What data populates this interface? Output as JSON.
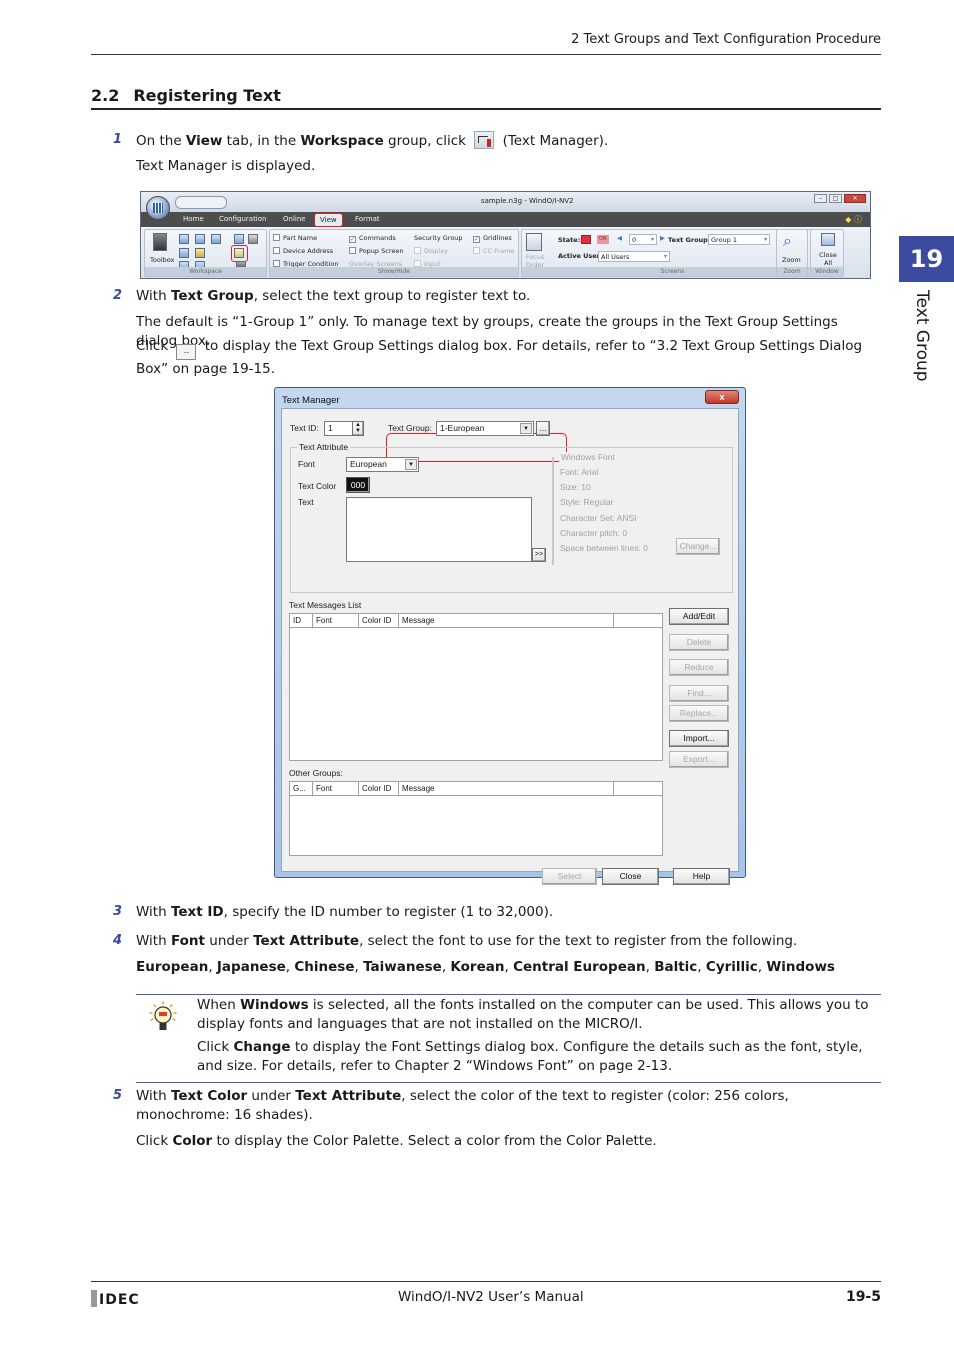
{
  "header": {
    "running_title": "2 Text Groups and Text Configuration Procedure"
  },
  "section": {
    "number": "2.2",
    "title": "Registering Text"
  },
  "chapter_tab": {
    "number": "19",
    "label": "Text Group",
    "color": "#3c4aa0"
  },
  "steps": {
    "s1": {
      "num": "1",
      "t1": "On the ",
      "b1": "View",
      "t2": " tab, in the ",
      "b2": "Workspace",
      "t3": " group, click ",
      "t4": " (Text Manager).",
      "icon": "text-manager-icon",
      "result": "Text Manager is displayed."
    },
    "s2": {
      "num": "2",
      "t1": "With ",
      "b1": "Text Group",
      "t2": ", select the text group to register text to.",
      "p2": "The default is “1-Group 1” only. To manage text by groups, create the groups in the Text Group Settings dialog box.",
      "p3a": "Click ",
      "p3_button": "..",
      "p3b": " to display the Text Group Settings dialog box. For details, refer to “3.2 Text Group Settings Dialog Box” on page 19-15."
    },
    "s3": {
      "num": "3",
      "t1": "With ",
      "b1": "Text ID",
      "t2": ", specify the ID number to register (1 to 32,000)."
    },
    "s4": {
      "num": "4",
      "t1": "With ",
      "b1": "Font",
      "t2": " under ",
      "b2": "Text Attribute",
      "t3": ", select the font to use for the text to register from the following.",
      "fonts": [
        "European",
        "Japanese",
        "Chinese",
        "Taiwanese",
        "Korean",
        "Central European",
        "Baltic",
        "Cyrillic",
        "Windows"
      ]
    },
    "s5": {
      "num": "5",
      "t1": "With ",
      "b1": "Text Color",
      "t2": " under ",
      "b2": "Text Attribute",
      "t3": ", select the color of the text to register (color: 256 colors, monochrome: 16 shades).",
      "p2a": "Click ",
      "p2b": "Color",
      "p2c": " to display the Color Palette. Select a color from the Color Palette."
    }
  },
  "note": {
    "icon": "lightbulb-icon",
    "l1a": "When ",
    "l1b": "Windows",
    "l1c": " is selected, all the fonts installed on the computer can be used. This allows you to display fonts and languages that are not installed on the MICRO/I.",
    "l2a": "Click ",
    "l2b": "Change",
    "l2c": " to display the Font Settings dialog box. Configure the details such as the font, style, and size. For details, refer to Chapter 2 “Windows Font” on page 2-13."
  },
  "ribbon": {
    "window_title": "sample.n3g - WindO/I-NV2",
    "tabs": [
      "Home",
      "Configuration",
      "Online",
      "View",
      "Format"
    ],
    "active_tab": "View",
    "workspace": {
      "toolbox": "Toolbox",
      "group_label": "Workspace"
    },
    "showhide": {
      "items": [
        {
          "label": "Part Name",
          "checked": false,
          "enabled": true
        },
        {
          "label": "Device Address",
          "checked": false,
          "enabled": true
        },
        {
          "label": "Trigger Condition",
          "checked": false,
          "enabled": true
        },
        {
          "label": "Commands",
          "checked": true,
          "enabled": true
        },
        {
          "label": "Popup Screen",
          "checked": false,
          "enabled": true
        },
        {
          "label": "Overlay Screens",
          "enabled": false
        },
        {
          "label": "Security Group",
          "enabled": true
        },
        {
          "label": "Display",
          "checked": false,
          "enabled": false
        },
        {
          "label": "Input",
          "checked": false,
          "enabled": false
        },
        {
          "label": "Gridlines",
          "checked": true,
          "enabled": true
        },
        {
          "label": "CC Frame",
          "checked": false,
          "enabled": false
        }
      ],
      "group_label": "Show/Hide"
    },
    "screens": {
      "focus_order": "Focus Order",
      "state_label": "State:",
      "state_value": "0",
      "on_badge": "ON",
      "text_group_label": "Text Group:",
      "text_group_value": "Group 1",
      "active_user_label": "Active User:",
      "active_user_value": "All Users",
      "group_label": "Screens"
    },
    "zoom": {
      "label": "Zoom",
      "group_label": "Zoom"
    },
    "window": {
      "label": "Close All",
      "group_label": "Window"
    }
  },
  "dialog": {
    "title": "Text Manager",
    "close": "x",
    "text_id_label": "Text ID:",
    "text_id_value": "1",
    "text_group_label": "Text Group:",
    "text_group_value": "1-European",
    "text_group_button": "...",
    "text_attribute_legend": "Text Attribute",
    "font_label": "Font",
    "font_value": "European",
    "text_color_label": "Text Color",
    "text_color_value": "000",
    "text_label": "Text",
    "expand_button": ">>",
    "windows_font": {
      "legend": "Windows Font",
      "font": "Font:   Arial",
      "size": "Size:   10",
      "style": "Style:    Regular",
      "charset": "Character Set:   ANSI",
      "pitch": "Character pitch:   0",
      "spacing": "Space between lines:   0",
      "change_button": "Change..."
    },
    "messages_list_label": "Text Messages List",
    "messages_columns": [
      "ID",
      "Font",
      "Color ID",
      "Message",
      ""
    ],
    "other_groups_label": "Other Groups:",
    "other_columns": [
      "G...",
      "Font",
      "Color ID",
      "Message",
      ""
    ],
    "side_buttons": [
      {
        "label": "Add/Edit",
        "enabled": true
      },
      {
        "label": "Delete",
        "enabled": false
      },
      {
        "label": "Reduce",
        "enabled": false
      },
      {
        "label": "Find...",
        "enabled": false
      },
      {
        "label": "Replace...",
        "enabled": false
      },
      {
        "label": "Import...",
        "enabled": true
      },
      {
        "label": "Export...",
        "enabled": false
      }
    ],
    "bottom_buttons": {
      "select": "Select",
      "close": "Close",
      "help": "Help"
    }
  },
  "footer": {
    "logo": "IDEC",
    "center": "WindO/I-NV2 User’s Manual",
    "page": "19-5"
  }
}
